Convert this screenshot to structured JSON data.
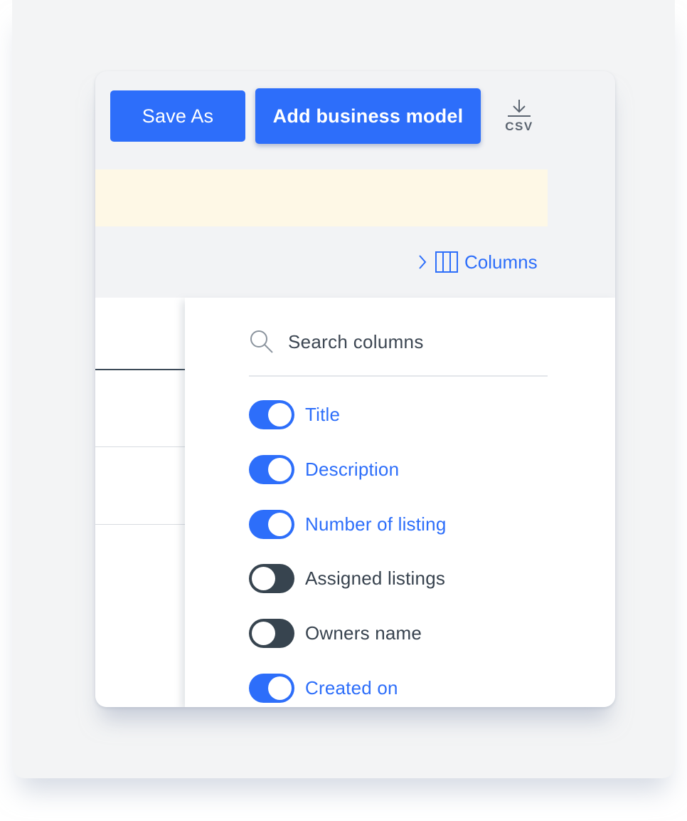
{
  "toolbar": {
    "save_as_label": "Save As",
    "add_label": "Add business model",
    "csv_label": "CSV",
    "csv_icon": "download-icon"
  },
  "columns_toggle": {
    "label": "Columns",
    "chevron_icon": "chevron-right-icon",
    "columns_icon": "columns-icon"
  },
  "column_panel": {
    "search": {
      "placeholder": "Search columns",
      "icon": "search-icon"
    },
    "options": [
      {
        "label": "Title",
        "enabled": true
      },
      {
        "label": "Description",
        "enabled": true
      },
      {
        "label": "Number of listing",
        "enabled": true
      },
      {
        "label": "Assigned listings",
        "enabled": false
      },
      {
        "label": "Owners name",
        "enabled": false
      },
      {
        "label": "Created on",
        "enabled": true
      }
    ]
  },
  "colors": {
    "accent": "#2d6efa",
    "toggle_off": "#37444f",
    "notice_bg": "#fef8e6"
  }
}
